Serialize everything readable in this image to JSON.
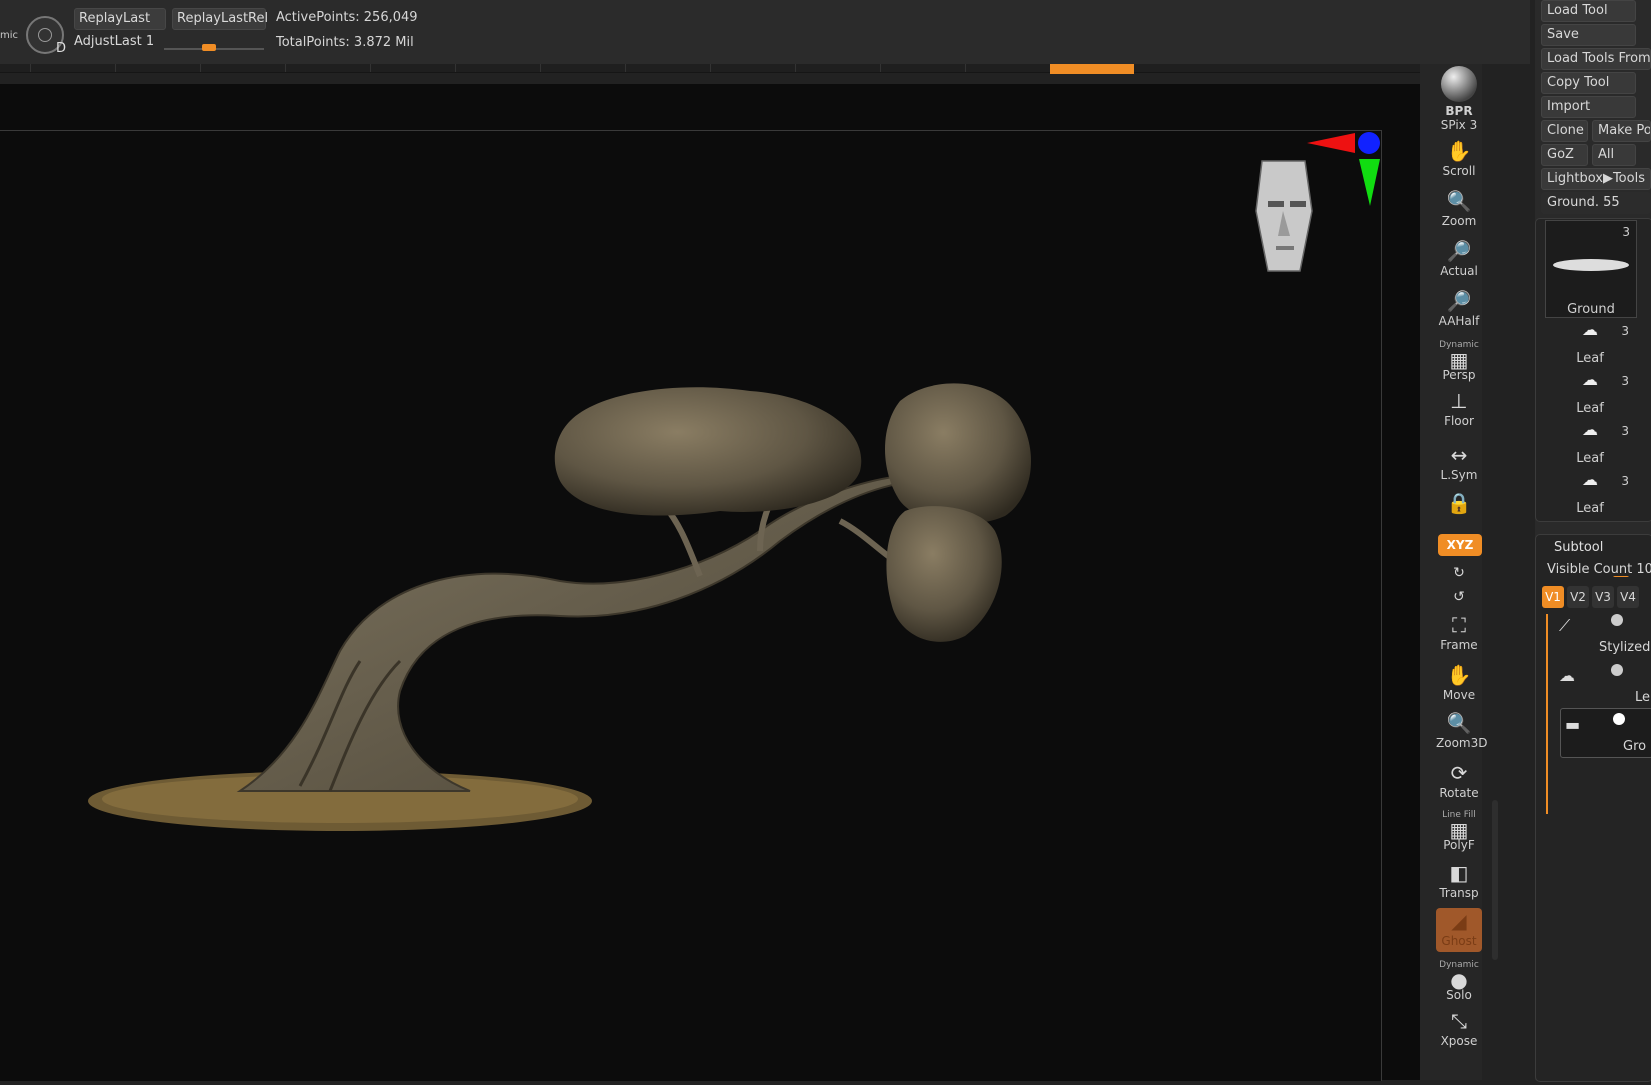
{
  "top": {
    "dynamic_label": "mic",
    "d_label": "D",
    "replay_last": "ReplayLast",
    "replay_last_rel": "ReplayLastRel",
    "adjust_last_label": "AdjustLast",
    "adjust_last_value": "1",
    "active_points": "ActivePoints: 256,049",
    "total_points": "TotalPoints: 3.872 Mil"
  },
  "shelf": {
    "bpr": "BPR",
    "spix": "SPix 3",
    "scroll": "Scroll",
    "zoom": "Zoom",
    "actual": "Actual",
    "aahalf": "AAHalf",
    "dynamic_top": "Dynamic",
    "persp": "Persp",
    "floor": "Floor",
    "lsym": "L.Sym",
    "xyz": "XYZ",
    "frame": "Frame",
    "move": "Move",
    "zoom3d": "Zoom3D",
    "rotate": "Rotate",
    "line_fill": "Line Fill",
    "polyf": "PolyF",
    "transp": "Transp",
    "ghost": "Ghost",
    "dynamic_solo": "Dynamic",
    "solo": "Solo",
    "xpose": "Xpose"
  },
  "tool_panel": {
    "load_tool": "Load Tool",
    "save": "Save",
    "load_tools_from": "Load Tools From",
    "copy_tool": "Copy Tool",
    "import": "Import",
    "clone": "Clone",
    "make_po": "Make Po",
    "goz": "GoZ",
    "all": "All",
    "lightbox_tools": "Lightbox▶Tools",
    "current_tool": "Ground. 55",
    "thumbs": [
      {
        "name": "Ground",
        "count": "3"
      },
      {
        "name": "Leaf",
        "count": "3"
      },
      {
        "name": "Leaf",
        "count": "3"
      },
      {
        "name": "Leaf",
        "count": "3"
      },
      {
        "name": "Leaf",
        "count": "3"
      }
    ]
  },
  "subtool": {
    "title": "Subtool",
    "visible_count_label": "Visible Count",
    "visible_count_value": "10",
    "tabs": [
      "V1",
      "V2",
      "V3",
      "V4"
    ],
    "items": [
      "Stylized",
      "Le",
      "Gro"
    ]
  }
}
